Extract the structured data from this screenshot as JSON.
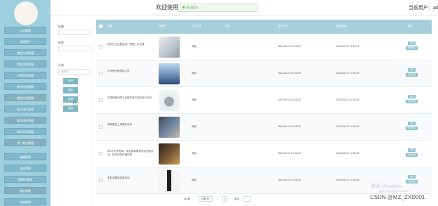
{
  "sidebar": {
    "items": [
      {
        "label": "公告管理"
      },
      {
        "label": "商家用户"
      },
      {
        "label": "商品分类管理"
      },
      {
        "label": "商品信息管理"
      },
      {
        "label": "订单信息管理"
      },
      {
        "label": "收货信息管理"
      },
      {
        "label": "类别信息管理"
      },
      {
        "label": "宝贝排行管理"
      },
      {
        "label": "商品评价管理"
      },
      {
        "label": "评价信息管理"
      },
      {
        "label": "热门商品管理"
      },
      {
        "label": "轮播管理"
      },
      {
        "label": "会员管理"
      },
      {
        "label": "管理员管理"
      },
      {
        "label": "留言管理"
      },
      {
        "label": "系统管理"
      }
    ]
  },
  "header": {
    "title": "欢迎使用校园代购系统",
    "user_label": "当前用户：admin",
    "toast": "退出成功!"
  },
  "filters": {
    "title_label": "标题",
    "tag_label": "标签",
    "category_label": "分类",
    "category_placeholder": "请选择",
    "buttons": [
      "查询",
      "删除",
      "重置",
      "添加"
    ]
  },
  "table": {
    "headers": [
      "标题",
      "封面图",
      "文章分类",
      "标签",
      "发布时间",
      "更新时间",
      "操作"
    ],
    "rows": [
      {
        "title": "如何在生活里运用？校园二手交易",
        "type": "商品",
        "created": "2024-05-27 14:32:25",
        "updated": "2024-05-27 15:14:21"
      },
      {
        "title": "小长假去哪里玩才好",
        "type": "商品",
        "created": "2024-05-27 14:32:25",
        "updated": "2024-05-27 14:32:25"
      },
      {
        "title": "中国校园代购平台服务用户的好处与分析",
        "type": "商品",
        "created": "2024-05-27 14:32:25",
        "updated": "2024-05-27 14:32:25"
      },
      {
        "title": "商家新品上架推荐活动",
        "type": "商品",
        "created": "2024-05-27 14:32:25",
        "updated": "2024-05-27 14:32:25"
      },
      {
        "title": "800小时不断电！学校招新服务协会代购活动，校内代购价格实惠",
        "type": "商品",
        "created": "2024-05-27 14:32:25",
        "updated": "2024-05-27 14:32:25"
      },
      {
        "title": "手机及数码优惠活动",
        "type": "商品",
        "created": "2024-05-27 14:32:25",
        "updated": "2024-05-27 14:32:25"
      }
    ],
    "op_edit": "详情",
    "op_more": "修改详情"
  },
  "pagination": {
    "total": "共6条",
    "page_size": "10条/页",
    "current": "1",
    "goto": "前往"
  },
  "overlay": {
    "windows_line1": "激活 Windows",
    "windows_line2": "转到“设置”以激活 Windows。",
    "csdn": "CSDN @MZ_ZXD001"
  },
  "colors": {
    "sidebar": "#9ecfdd",
    "table_header": "#a7cfdb",
    "button": "#7fb6c6"
  }
}
